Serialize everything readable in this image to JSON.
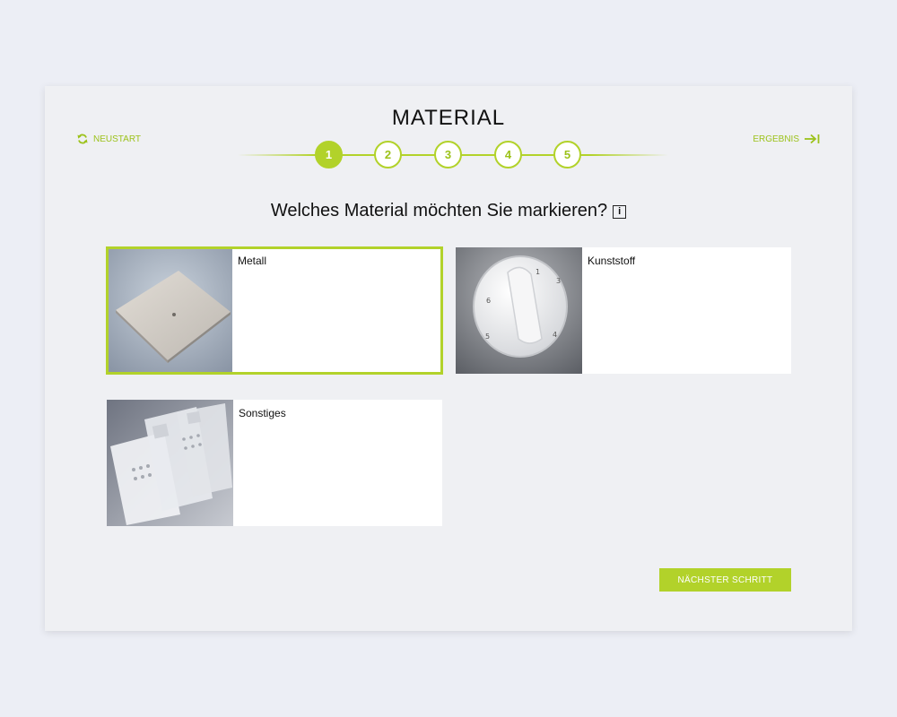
{
  "header": {
    "title": "MATERIAL",
    "restart_label": "NEUSTART",
    "result_label": "ERGEBNIS"
  },
  "stepper": {
    "steps": [
      "1",
      "2",
      "3",
      "4",
      "5"
    ],
    "active_step": "1"
  },
  "question": "Welches Material möchten Sie markieren?",
  "info_icon_text": "i",
  "options": [
    {
      "label": "Metall",
      "selected": true
    },
    {
      "label": "Kunststoff",
      "selected": false
    },
    {
      "label": "Sonstiges",
      "selected": false
    }
  ],
  "footer": {
    "next_label": "NÄCHSTER SCHRITT"
  },
  "colors": {
    "accent": "#b2d22a",
    "background": "#eceef5",
    "panel": "#eff0f3"
  },
  "icons": {
    "restart": "refresh-icon",
    "result": "arrow-right-to-bar-icon",
    "info": "info-icon"
  }
}
